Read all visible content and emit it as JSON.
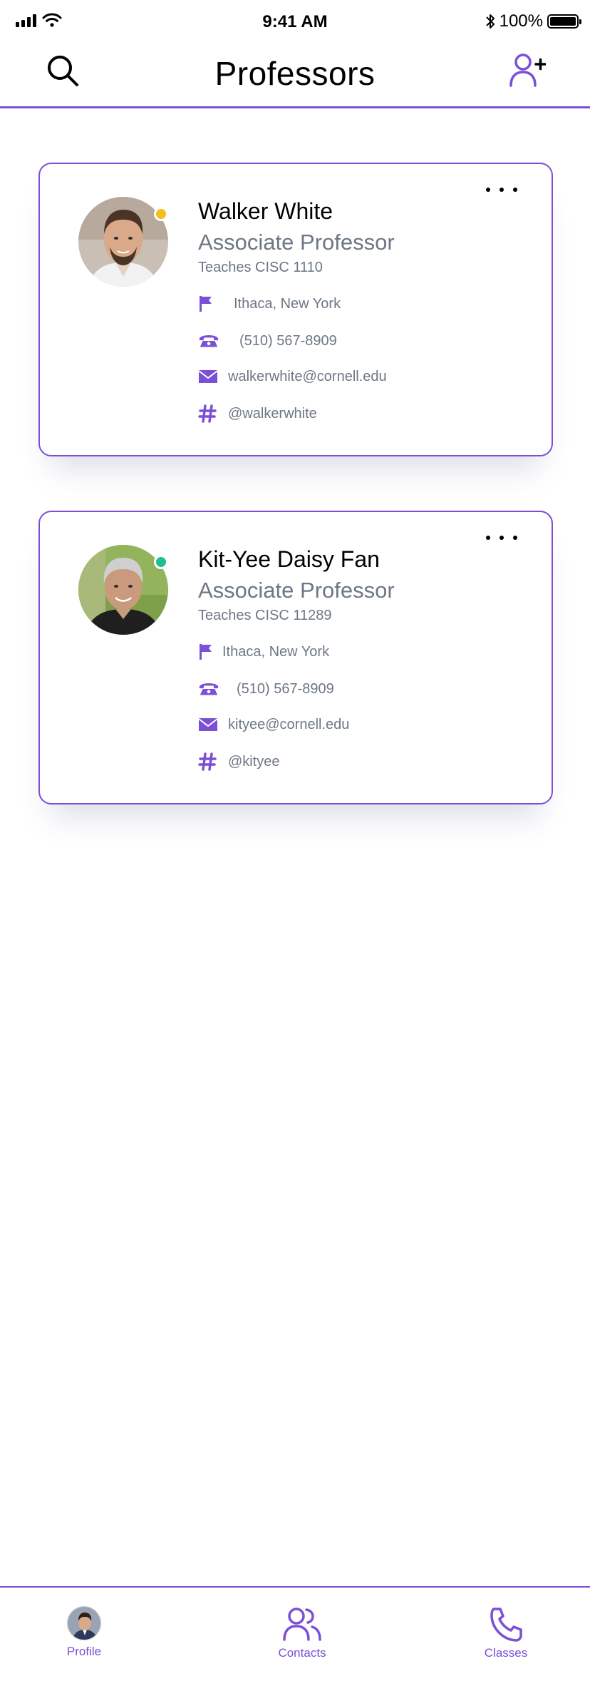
{
  "status_bar": {
    "time": "9:41 AM",
    "battery": "100%"
  },
  "header": {
    "title": "Professors"
  },
  "professors": [
    {
      "name": "Walker White",
      "title": "Associate Professor",
      "teaches": "Teaches CISC 1110",
      "location": "Ithaca, New York",
      "phone": "(510) 567-8909",
      "email": "walkerwhite@cornell.edu",
      "handle": "@walkerwhite",
      "status_color": "#f5bd1f"
    },
    {
      "name": "Kit-Yee Daisy Fan",
      "title": "Associate Professor",
      "teaches": "Teaches CISC 11289",
      "location": "Ithaca, New York",
      "phone": "(510) 567-8909",
      "email": "kityee@cornell.edu",
      "handle": "@kityee",
      "status_color": "#1fbf8f"
    }
  ],
  "tab_bar": {
    "profile_label": "Profile",
    "contacts_label": "Contacts",
    "classes_label": "Classes"
  },
  "theme": {
    "accent": "#7b4fd6",
    "secondary_text": "#6d7784"
  },
  "icons": {
    "search": "search-icon",
    "add_user": "add-user-icon",
    "location": "flag-icon",
    "phone": "phone-icon",
    "email": "envelope-icon",
    "handle": "hashtag-icon",
    "more": "more-icon",
    "contacts": "contacts-icon",
    "classes": "phone-outline-icon"
  }
}
